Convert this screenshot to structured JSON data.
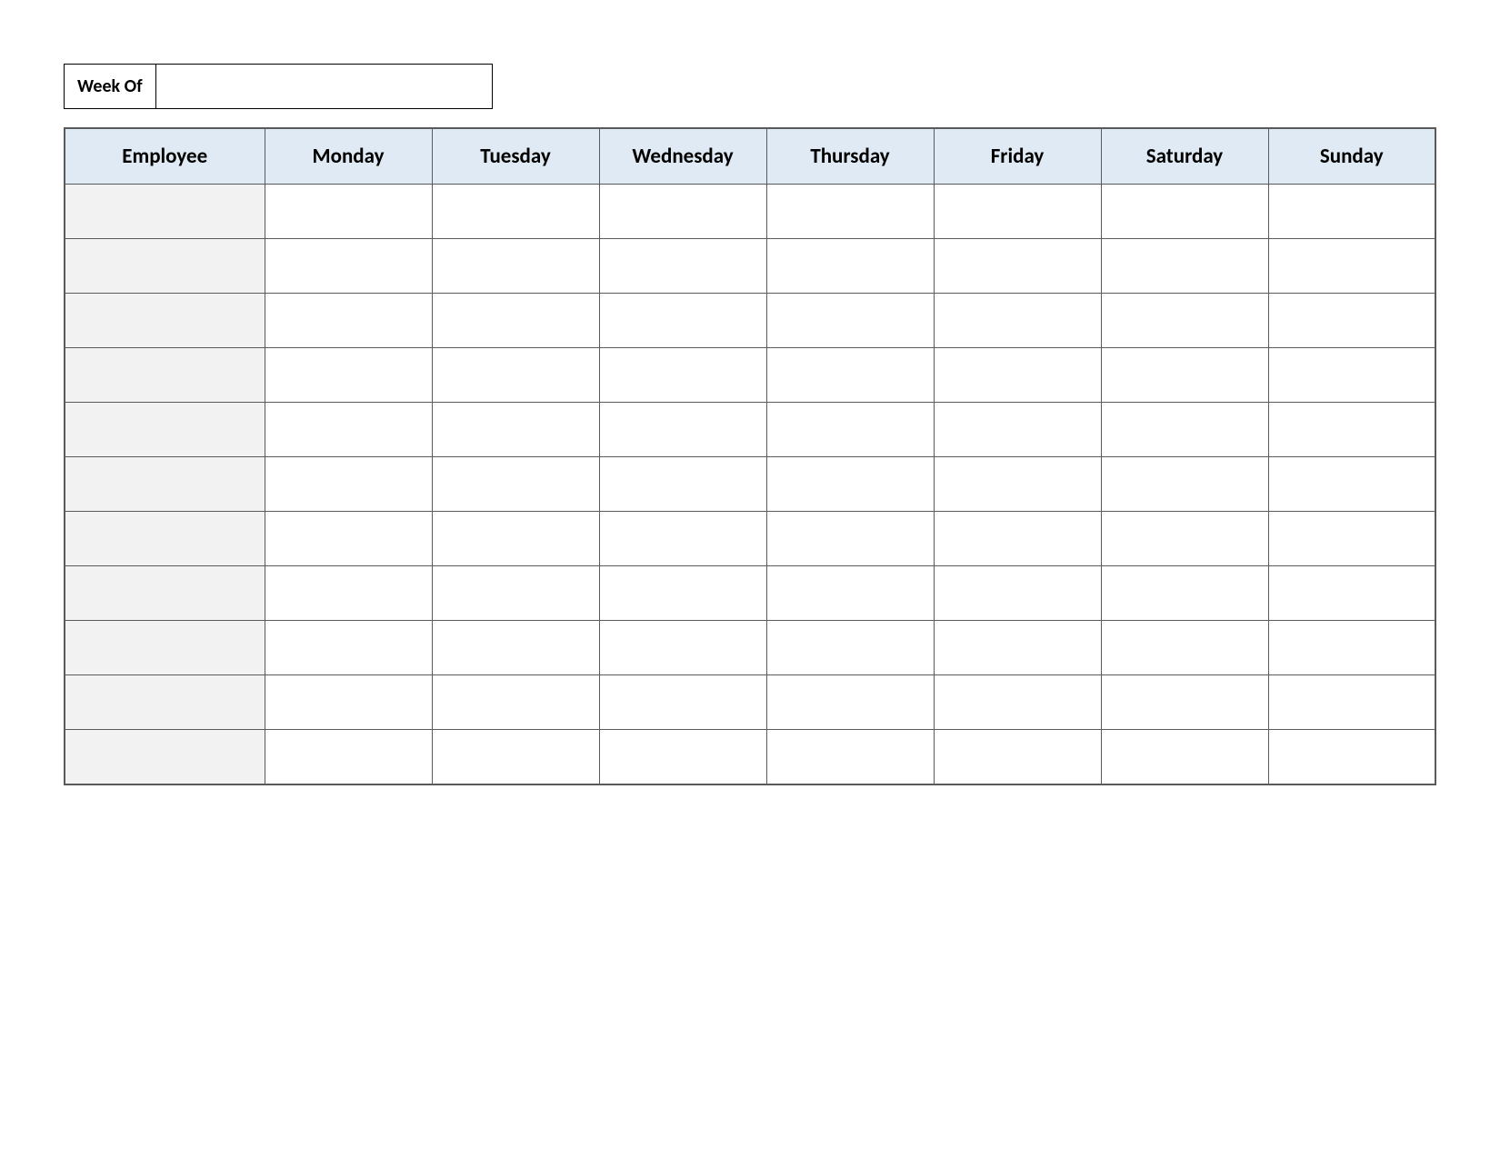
{
  "week_of": {
    "label": "Week Of",
    "value": ""
  },
  "table": {
    "headers": [
      "Employee",
      "Monday",
      "Tuesday",
      "Wednesday",
      "Thursday",
      "Friday",
      "Saturday",
      "Sunday"
    ],
    "rows": [
      {
        "employee": "",
        "monday": "",
        "tuesday": "",
        "wednesday": "",
        "thursday": "",
        "friday": "",
        "saturday": "",
        "sunday": ""
      },
      {
        "employee": "",
        "monday": "",
        "tuesday": "",
        "wednesday": "",
        "thursday": "",
        "friday": "",
        "saturday": "",
        "sunday": ""
      },
      {
        "employee": "",
        "monday": "",
        "tuesday": "",
        "wednesday": "",
        "thursday": "",
        "friday": "",
        "saturday": "",
        "sunday": ""
      },
      {
        "employee": "",
        "monday": "",
        "tuesday": "",
        "wednesday": "",
        "thursday": "",
        "friday": "",
        "saturday": "",
        "sunday": ""
      },
      {
        "employee": "",
        "monday": "",
        "tuesday": "",
        "wednesday": "",
        "thursday": "",
        "friday": "",
        "saturday": "",
        "sunday": ""
      },
      {
        "employee": "",
        "monday": "",
        "tuesday": "",
        "wednesday": "",
        "thursday": "",
        "friday": "",
        "saturday": "",
        "sunday": ""
      },
      {
        "employee": "",
        "monday": "",
        "tuesday": "",
        "wednesday": "",
        "thursday": "",
        "friday": "",
        "saturday": "",
        "sunday": ""
      },
      {
        "employee": "",
        "monday": "",
        "tuesday": "",
        "wednesday": "",
        "thursday": "",
        "friday": "",
        "saturday": "",
        "sunday": ""
      },
      {
        "employee": "",
        "monday": "",
        "tuesday": "",
        "wednesday": "",
        "thursday": "",
        "friday": "",
        "saturday": "",
        "sunday": ""
      },
      {
        "employee": "",
        "monday": "",
        "tuesday": "",
        "wednesday": "",
        "thursday": "",
        "friday": "",
        "saturday": "",
        "sunday": ""
      },
      {
        "employee": "",
        "monday": "",
        "tuesday": "",
        "wednesday": "",
        "thursday": "",
        "friday": "",
        "saturday": "",
        "sunday": ""
      }
    ]
  }
}
